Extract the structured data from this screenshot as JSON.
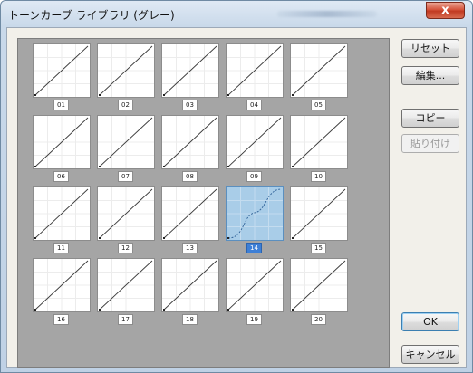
{
  "window": {
    "title": "トーンカーブ ライブラリ (グレー)",
    "close_glyph": "x"
  },
  "grid": {
    "selected_index": 13,
    "thumbnails": [
      {
        "label": "01",
        "curve": "linear"
      },
      {
        "label": "02",
        "curve": "linear"
      },
      {
        "label": "03",
        "curve": "linear"
      },
      {
        "label": "04",
        "curve": "linear"
      },
      {
        "label": "05",
        "curve": "linear"
      },
      {
        "label": "06",
        "curve": "linear"
      },
      {
        "label": "07",
        "curve": "linear"
      },
      {
        "label": "08",
        "curve": "linear"
      },
      {
        "label": "09",
        "curve": "linear"
      },
      {
        "label": "10",
        "curve": "linear"
      },
      {
        "label": "11",
        "curve": "linear"
      },
      {
        "label": "12",
        "curve": "linear"
      },
      {
        "label": "13",
        "curve": "linear"
      },
      {
        "label": "14",
        "curve": "s-curve"
      },
      {
        "label": "15",
        "curve": "linear"
      },
      {
        "label": "16",
        "curve": "linear"
      },
      {
        "label": "17",
        "curve": "linear"
      },
      {
        "label": "18",
        "curve": "linear"
      },
      {
        "label": "19",
        "curve": "linear"
      },
      {
        "label": "20",
        "curve": "linear"
      }
    ]
  },
  "buttons": {
    "reset": "リセット",
    "edit": "編集...",
    "copy": "コピー",
    "paste": "貼り付け",
    "ok": "OK",
    "cancel": "キャンセル"
  },
  "colors": {
    "grid_background": "#a5a5a5",
    "selected_thumbnail": "#a9cde8",
    "selected_label": "#3d7fd6",
    "close_button": "#d5543c"
  }
}
